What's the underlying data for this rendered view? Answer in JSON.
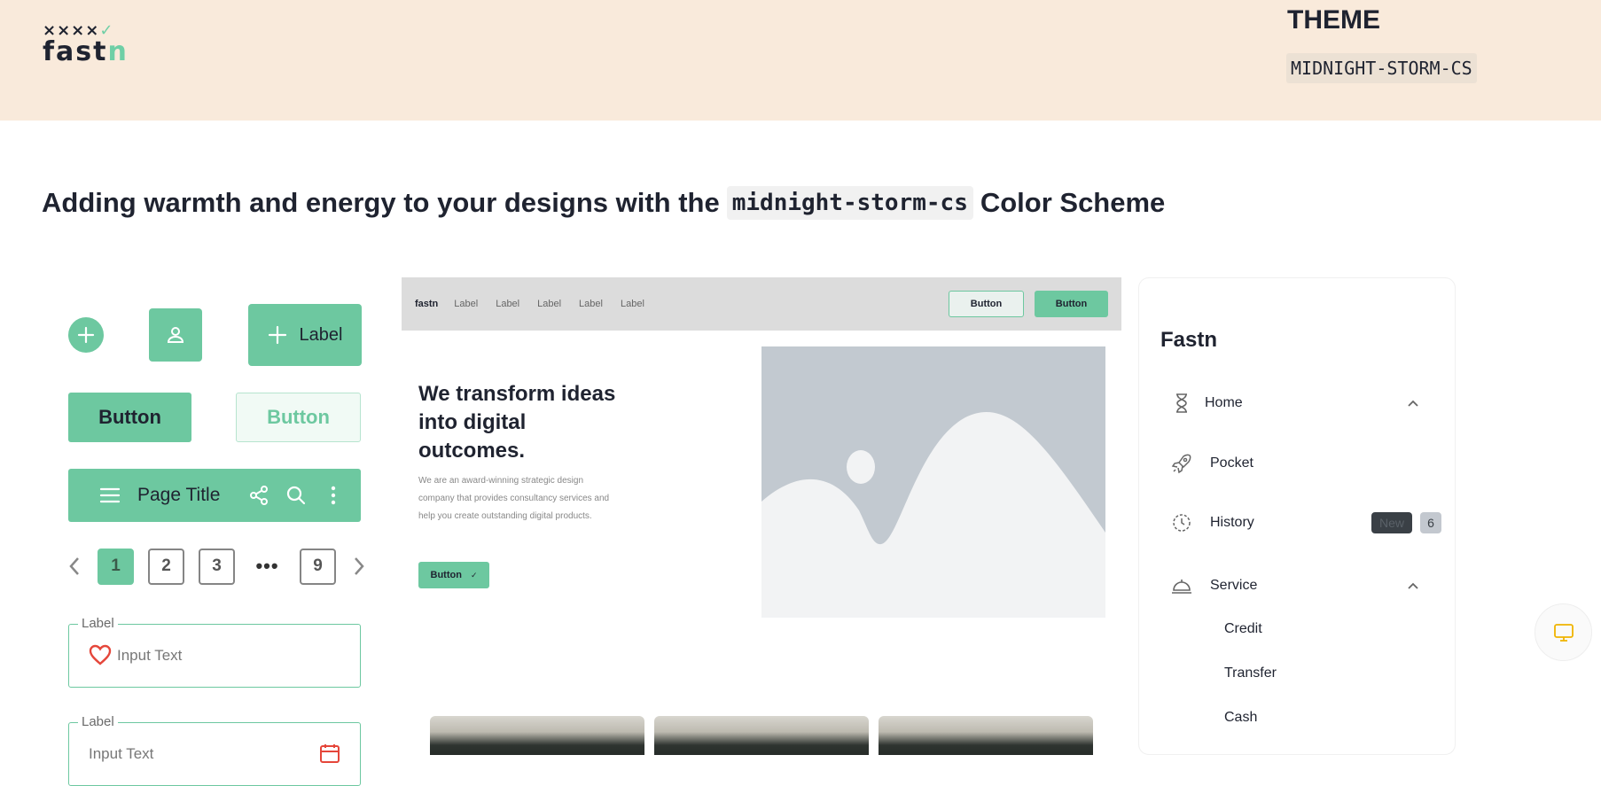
{
  "header": {
    "logo": {
      "top": "××××",
      "check": "✓",
      "word_main": "fast",
      "word_accent": "n"
    },
    "theme_title": "THEME",
    "theme_name": "MIDNIGHT-STORM-CS"
  },
  "headline": {
    "before": "Adding warmth and energy to your designs with the",
    "code": "midnight-storm-cs",
    "after": "Color Scheme"
  },
  "components": {
    "label_button": "Label",
    "solid_button": "Button",
    "outline_button": "Button",
    "appbar_title": "Page Title",
    "pager": {
      "pages": [
        "1",
        "2",
        "3",
        "9"
      ],
      "dots": "•••",
      "active": "1"
    },
    "field1": {
      "label": "Label",
      "value": "Input Text"
    },
    "field2": {
      "label": "Label",
      "value": "Input Text"
    }
  },
  "preview": {
    "brand": "fastn",
    "links": [
      "Label",
      "Label",
      "Label",
      "Label",
      "Label"
    ],
    "btn_outline": "Button",
    "btn_solid": "Button",
    "hero": "We transform ideas into digital outcomes.",
    "body": "We are an award-winning strategic design company that provides consultancy services and help you create outstanding digital products.",
    "cta": "Button",
    "cta_icon": "✓"
  },
  "sidebar": {
    "title": "Fastn",
    "items": [
      {
        "label": "Home",
        "icon": "hourglass-icon"
      },
      {
        "label": "Pocket",
        "icon": "rocket-icon"
      },
      {
        "label": "History",
        "icon": "history-icon",
        "badge": "New",
        "count": "6"
      },
      {
        "label": "Service",
        "icon": "service-bell-icon"
      }
    ],
    "sub_items": [
      "Credit",
      "Transfer",
      "Cash"
    ]
  },
  "colors": {
    "accent": "#6dc8a0",
    "header_bg": "#f9eadb",
    "ink": "#1f2330"
  }
}
